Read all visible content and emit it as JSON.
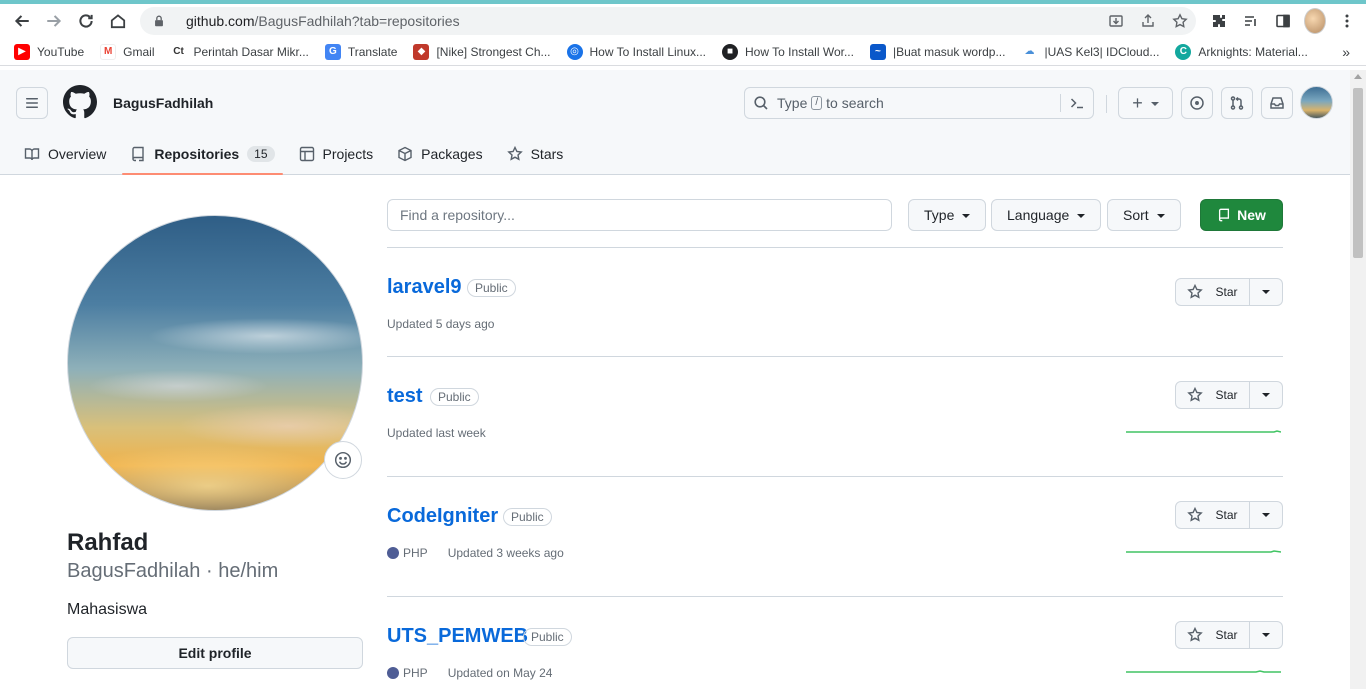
{
  "browser": {
    "url_host": "github.com",
    "url_path": "/BagusFadhilah?tab=repositories",
    "bookmarks": [
      {
        "label": "YouTube",
        "icon": "youtube-icon",
        "color": "#ff0000"
      },
      {
        "label": "Gmail",
        "icon": "gmail-icon",
        "color": "#ea4335"
      },
      {
        "label": "Perintah Dasar Mikr...",
        "icon": "ct-icon",
        "color": "#333333"
      },
      {
        "label": "Translate",
        "icon": "translate-icon",
        "color": "#4285f4"
      },
      {
        "label": "[Nike] Strongest Ch...",
        "icon": "nike-icon",
        "color": "#c0392b"
      },
      {
        "label": "How To Install Linux...",
        "icon": "linux-site-icon",
        "color": "#1a73e8"
      },
      {
        "label": "How To Install Wor...",
        "icon": "wordpress-site-icon",
        "color": "#202124"
      },
      {
        "label": "|Buat masuk wordp...",
        "icon": "wordpress-login-icon",
        "color": "#0a58ca"
      },
      {
        "label": "|UAS Kel3| IDCloud...",
        "icon": "cloud-icon",
        "color": "#4a90d9"
      },
      {
        "label": "Arknights: Material...",
        "icon": "arknights-icon",
        "color": "#13a89e"
      }
    ],
    "bookmarks_more": "»"
  },
  "header": {
    "username": "BagusFadhilah",
    "search_prefix": "Type",
    "search_key": "/",
    "search_suffix": "to search",
    "plus_label": "+"
  },
  "tabs": [
    {
      "label": "Overview",
      "icon": "book-icon"
    },
    {
      "label": "Repositories",
      "icon": "repo-icon",
      "count": "15"
    },
    {
      "label": "Projects",
      "icon": "table-icon"
    },
    {
      "label": "Packages",
      "icon": "package-icon"
    },
    {
      "label": "Stars",
      "icon": "star-icon"
    }
  ],
  "profile": {
    "name": "Rahfad",
    "handle": "BagusFadhilah · he/him",
    "bio": "Mahasiswa",
    "edit_label": "Edit profile"
  },
  "filters": {
    "search_placeholder": "Find a repository...",
    "type_label": "Type",
    "language_label": "Language",
    "sort_label": "Sort",
    "new_label": "New"
  },
  "repos": [
    {
      "name": "laravel9",
      "visibility": "Public",
      "language": "",
      "updated": "Updated 5 days ago",
      "star_label": "Star"
    },
    {
      "name": "test",
      "visibility": "Public",
      "language": "",
      "updated": "Updated last week",
      "star_label": "Star"
    },
    {
      "name": "CodeIgniter",
      "visibility": "Public",
      "language": "PHP",
      "updated": "Updated 3 weeks ago",
      "star_label": "Star"
    },
    {
      "name": "UTS_PEMWEB",
      "visibility": "Public",
      "language": "PHP",
      "updated": "Updated on May 24",
      "star_label": "Star"
    }
  ],
  "colors": {
    "link": "#0969da",
    "primary_button": "#1f883d",
    "active_tab_underline": "#fd8c73",
    "php": "#4F5D95",
    "sparkline": "#40c463"
  }
}
